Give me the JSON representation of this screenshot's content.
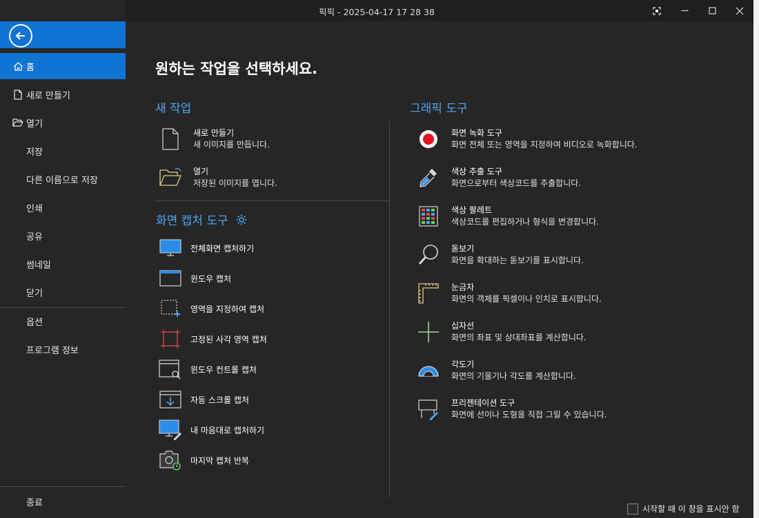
{
  "window": {
    "title": "픽픽 - 2025-04-17 17 28 38",
    "buttons": {
      "screenshot": "⛶",
      "minimize": "—",
      "maximize": "☐",
      "close": "✕"
    }
  },
  "sidebar": {
    "items": [
      {
        "label": "홈",
        "icon": "home-icon"
      },
      {
        "label": "새로 만들기",
        "icon": "new-file-icon"
      },
      {
        "label": "열기",
        "icon": "open-folder-icon"
      },
      {
        "label": "저장"
      },
      {
        "label": "다른 이름으로 저장"
      },
      {
        "label": "인쇄"
      },
      {
        "label": "공유"
      },
      {
        "label": "썸네일"
      },
      {
        "label": "닫기"
      },
      {
        "label": "옵션"
      },
      {
        "label": "프로그램 정보"
      },
      {
        "label": "종료"
      }
    ]
  },
  "main": {
    "heading": "원하는 작업을 선택하세요.",
    "new_task": {
      "title": "새 작업",
      "items": [
        {
          "title": "새로 만들기",
          "desc": "새 이미지를 만듭니다."
        },
        {
          "title": "열기",
          "desc": "저장된 이미지를 엽니다."
        }
      ]
    },
    "capture": {
      "title": "화면 캡처 도구",
      "items": [
        "전체화면 캡처하기",
        "윈도우 캡처",
        "영역을 지정하여 캡처",
        "고정된 사각 영역 캡처",
        "윈도우 컨트롤 캡처",
        "자동 스크롤 캡처",
        "내 마음대로 캡처하기",
        "마지막 캡처 반복"
      ]
    },
    "graphics": {
      "title": "그래픽 도구",
      "items": [
        {
          "title": "화면 녹화 도구",
          "desc": "화면 전체 또는 영역을 지정하여 비디오로 녹화합니다."
        },
        {
          "title": "색상 추출 도구",
          "desc": "화면으로부터 색상코드를 추출합니다."
        },
        {
          "title": "색상 팔레트",
          "desc": "색상코드를 편집하거나 형식을 변경합니다."
        },
        {
          "title": "돋보기",
          "desc": "화면을 확대하는 돋보기를 표시합니다."
        },
        {
          "title": "눈금자",
          "desc": "화면의 객체를 픽셀이나 인치로 표시합니다."
        },
        {
          "title": "십자선",
          "desc": "화면의 좌표 및 상대좌표를 계산합니다."
        },
        {
          "title": "각도기",
          "desc": "화면의 기울기나 각도를 계산합니다."
        },
        {
          "title": "프리젠테이션 도구",
          "desc": "화면에 선이나 도형을 직접 그릴 수 있습니다."
        }
      ]
    }
  },
  "footer": {
    "checkbox_label": "시작할 때 이 창을 표시안 함",
    "checked": false
  },
  "colors": {
    "accent": "#1173d3",
    "section": "#4ea5f4",
    "record": "#e81123"
  }
}
